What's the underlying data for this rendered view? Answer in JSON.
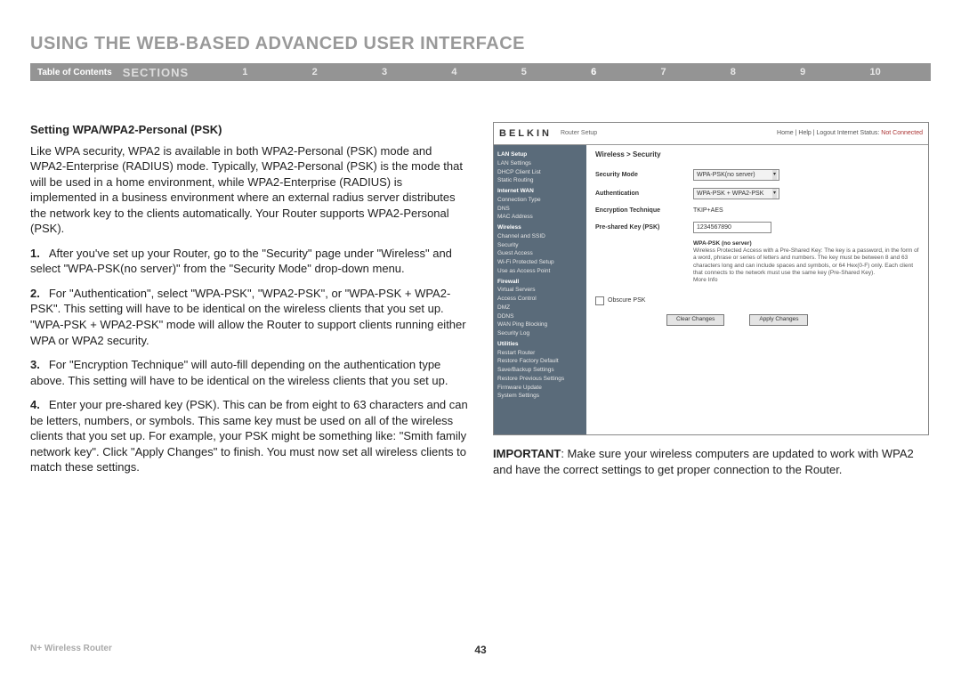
{
  "title": "USING THE WEB-BASED ADVANCED USER INTERFACE",
  "nav": {
    "toc": "Table of Contents",
    "sections_label": "SECTIONS",
    "items": [
      "1",
      "2",
      "3",
      "4",
      "5",
      "6",
      "7",
      "8",
      "9",
      "10"
    ],
    "active_index": 5
  },
  "left": {
    "heading": "Setting WPA/WPA2-Personal (PSK)",
    "intro": "Like WPA security, WPA2 is available in both WPA2-Personal (PSK) mode and WPA2-Enterprise (RADIUS) mode. Typically, WPA2-Personal (PSK) is the mode that will be used in a home environment, while WPA2-Enterprise (RADIUS) is implemented in a business environment where an external radius server distributes the network key to the clients automatically. Your Router supports WPA2-Personal (PSK).",
    "steps": [
      {
        "num": "1.",
        "text": "After you've set up your Router, go to the \"Security\" page under \"Wireless\" and select \"WPA-PSK(no server)\" from the \"Security Mode\" drop-down menu."
      },
      {
        "num": "2.",
        "text": "For \"Authentication\", select \"WPA-PSK\", \"WPA2-PSK\", or \"WPA-PSK + WPA2-PSK\". This setting will have to be identical on the wireless clients that you set up. \"WPA-PSK + WPA2-PSK\" mode will allow the Router to support clients running either WPA or WPA2 security."
      },
      {
        "num": "3.",
        "text": "For \"Encryption Technique\" will auto-fill depending on the authentication type above. This setting will have to be identical on the wireless clients that you set up."
      },
      {
        "num": "4.",
        "text": "Enter your pre-shared key (PSK). This can be from eight to 63 characters and can be letters, numbers, or symbols. This same key must be used on all of the wireless clients that you set up. For example, your PSK might be something like: \"Smith family network key\". Click \"Apply Changes\" to finish. You must now set all wireless clients to match these settings."
      }
    ]
  },
  "router": {
    "brand": "BELKIN",
    "setup_label": "Router Setup",
    "top_right_links": "Home | Help | Logout   Internet Status:",
    "top_right_status": "Not Connected",
    "sidebar": {
      "groups": [
        {
          "head": "LAN Setup",
          "items": [
            "LAN Settings",
            "DHCP Client List",
            "Static Routing"
          ]
        },
        {
          "head": "Internet WAN",
          "items": [
            "Connection Type",
            "DNS",
            "MAC Address"
          ]
        },
        {
          "head": "Wireless",
          "items": [
            "Channel and SSID",
            "Security",
            "Guest Access",
            "Wi-Fi Protected Setup",
            "Use as Access Point"
          ]
        },
        {
          "head": "Firewall",
          "items": [
            "Virtual Servers",
            "Access Control",
            "DMZ",
            "DDNS",
            "WAN Ping Blocking",
            "Security Log"
          ]
        },
        {
          "head": "Utilities",
          "items": [
            "Restart Router",
            "Restore Factory Default",
            "Save/Backup Settings",
            "Restore Previous Settings",
            "Firmware Update",
            "System Settings"
          ]
        }
      ]
    },
    "main": {
      "breadcrumb": "Wireless > Security",
      "rows": {
        "sec_mode_label": "Security Mode",
        "sec_mode_value": "WPA-PSK(no server)",
        "auth_label": "Authentication",
        "auth_value": "WPA-PSK + WPA2-PSK",
        "enc_label": "Encryption Technique",
        "enc_value": "TKIP+AES",
        "psk_label": "Pre-shared Key (PSK)",
        "psk_value": "1234567890"
      },
      "note_head": "WPA-PSK (no server)",
      "note_body": "Wireless Protected Access with a Pre-Shared Key: The key is a password, in the form of a word, phrase or series of letters and numbers. The key must be between 8 and 63 characters long and can include spaces and symbols, or 64 Hex(0-F) only. Each client that connects to the network must use the same key (Pre-Shared Key).",
      "note_more": "More Info",
      "obscure_label": "Obscure PSK",
      "btn_clear": "Clear Changes",
      "btn_apply": "Apply Changes"
    }
  },
  "important": {
    "label": "IMPORTANT",
    "text": ": Make sure your wireless computers are updated to work with WPA2 and have the correct settings to get proper connection to the Router."
  },
  "footer": {
    "left": "N+ Wireless Router",
    "page": "43"
  }
}
